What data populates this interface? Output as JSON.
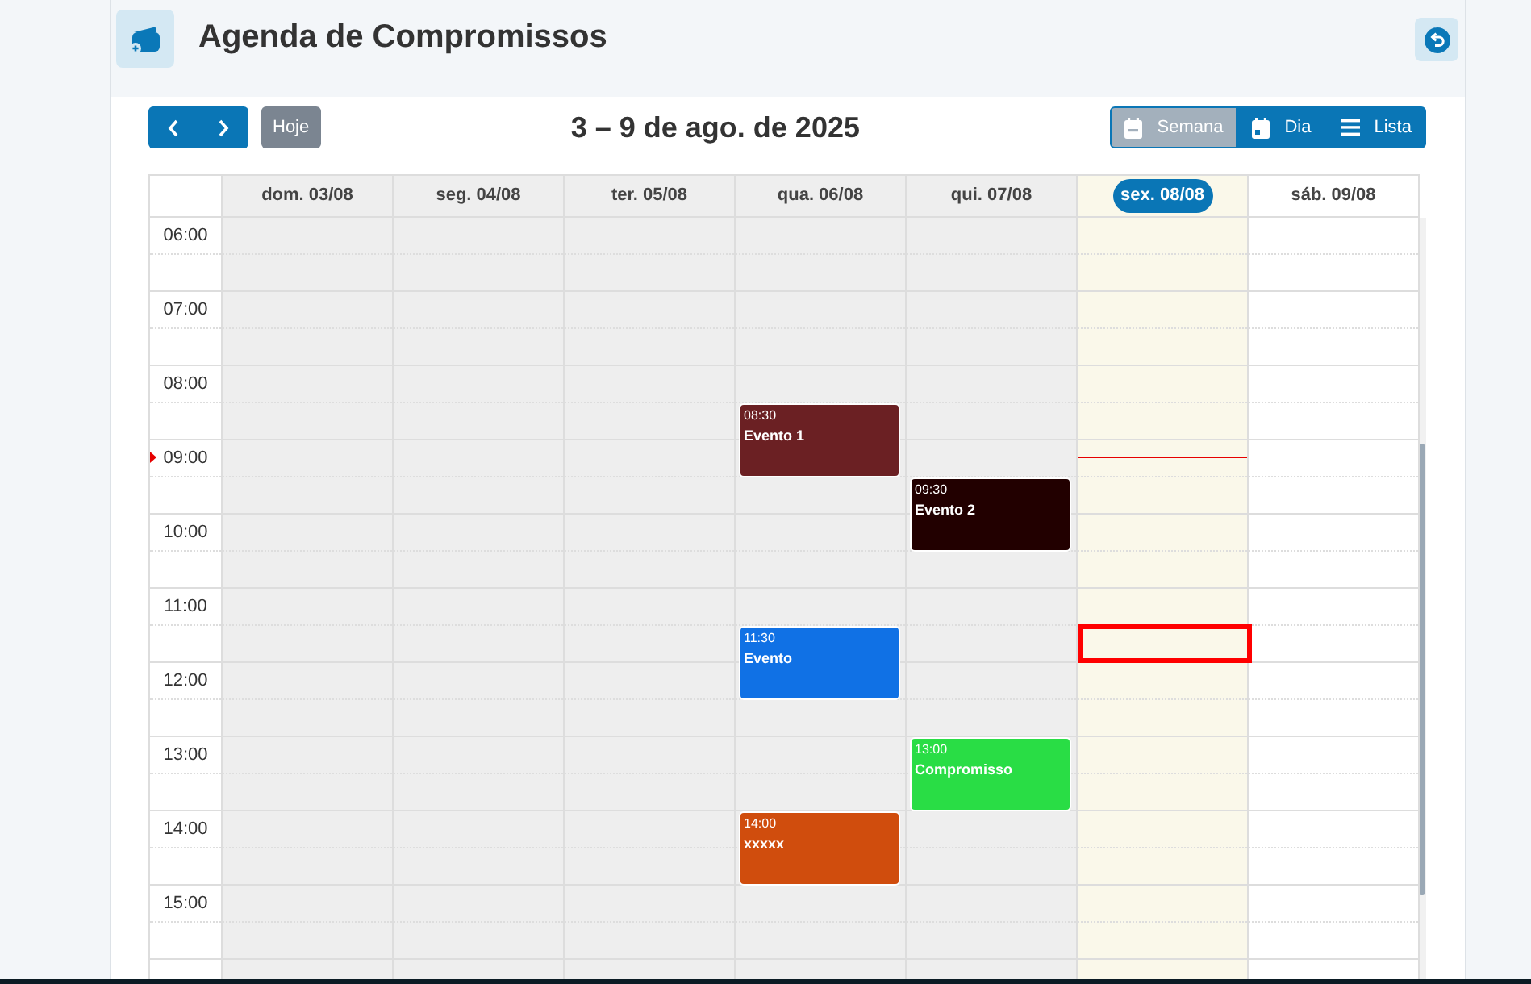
{
  "header": {
    "title": "Agenda de Compromissos"
  },
  "toolbar": {
    "title": "3 – 9 de ago. de 2025",
    "today_button": "Hoje",
    "views": [
      {
        "label": "Semana",
        "kind": "week",
        "selected": true
      },
      {
        "label": "Dia",
        "kind": "day",
        "selected": false
      },
      {
        "label": "Lista",
        "kind": "list",
        "selected": false
      }
    ]
  },
  "calendar": {
    "days": [
      {
        "label": "dom. 03/08",
        "kind": "past",
        "selected": false
      },
      {
        "label": "seg. 04/08",
        "kind": "past",
        "selected": false
      },
      {
        "label": "ter. 05/08",
        "kind": "past",
        "selected": false
      },
      {
        "label": "qua. 06/08",
        "kind": "past",
        "selected": false,
        "events": [
          {
            "time": "08:30",
            "title": "Evento 1",
            "color": "#6b2023"
          },
          {
            "time": "11:30",
            "title": "Evento",
            "color": "#1071e5"
          },
          {
            "time": "14:00",
            "title": "xxxxx",
            "color": "#d04d0d"
          }
        ]
      },
      {
        "label": "qui. 07/08",
        "kind": "past",
        "selected": false,
        "events": [
          {
            "time": "09:30",
            "title": "Evento 2",
            "color": "#220000"
          },
          {
            "time": "13:00",
            "title": "Compromisso",
            "color": "#29dd45"
          }
        ]
      },
      {
        "label": "sex. 08/08",
        "kind": "today",
        "selected": true
      },
      {
        "label": "sáb. 09/08",
        "kind": "future",
        "selected": false
      }
    ],
    "hours": [
      {
        "label": "06:00",
        "current": false,
        "selected": false
      },
      {
        "label": "07:00",
        "current": false,
        "selected": false
      },
      {
        "label": "08:00",
        "current": false,
        "selected": false
      },
      {
        "label": "09:00",
        "current": true,
        "selected": false
      },
      {
        "label": "10:00",
        "current": false,
        "selected": false
      },
      {
        "label": "11:00",
        "current": false,
        "selected": true
      },
      {
        "label": "12:00",
        "current": false,
        "selected": false
      },
      {
        "label": "13:00",
        "current": false,
        "selected": false
      },
      {
        "label": "14:00",
        "current": false,
        "selected": false
      },
      {
        "label": "15:00",
        "current": false,
        "selected": false
      }
    ]
  }
}
